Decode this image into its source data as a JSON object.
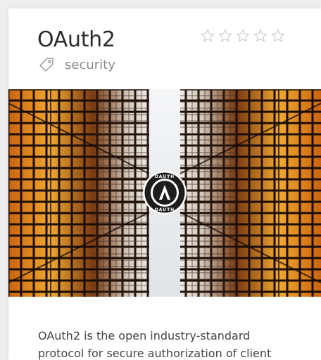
{
  "card": {
    "title": "OAuth2",
    "rating": {
      "value": 0,
      "max": 5
    },
    "tag": {
      "icon": "tag-icon",
      "label": "security"
    },
    "hero": {
      "description": "Skyscraper-canyon photo looking up between glass towers with a circular OAuth badge in the center",
      "badge": {
        "letter": "A",
        "ring_text_top": "OAUTH",
        "ring_text_bottom": "OAUTH"
      }
    },
    "description": "OAuth2 is the open industry-standard protocol for secure authorization of client"
  },
  "colors": {
    "star_outline": "#cfcfcf",
    "tag_icon": "#9a9a9a",
    "title": "#2b2b2b",
    "muted_text": "#8a8a8a",
    "body_text": "#444444"
  }
}
